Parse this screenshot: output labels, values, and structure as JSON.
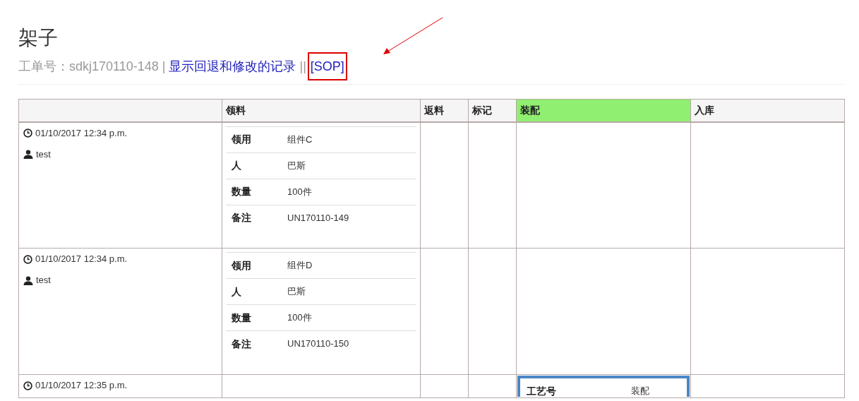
{
  "page": {
    "title": "架子",
    "order_label": "工单号：",
    "order_number": "sdkj170110-148",
    "separator": "|",
    "history_link": "显示回退和修改的记录",
    "separator_2": "||",
    "sop_link": "[SOP]",
    "sop_highlighted": true
  },
  "table": {
    "columns": [
      {
        "highlighted": false
      },
      {
        "label": "领料",
        "highlighted": false
      },
      {
        "label": "返料",
        "highlighted": false
      },
      {
        "label": "标记",
        "highlighted": false
      },
      {
        "label": "装配",
        "highlighted": true
      },
      {
        "label": "入库",
        "highlighted": false
      }
    ],
    "rows": [
      {
        "time": "01/10/2017 12:34 p.m.",
        "user": "test",
        "requisition": [
          {
            "label": "领用",
            "value": "组件C"
          },
          {
            "label": "人",
            "value": "巴斯"
          },
          {
            "label": "数量",
            "value": "100件"
          },
          {
            "label": "备注",
            "value": "UN170110-149"
          }
        ],
        "assembly": []
      },
      {
        "time": "01/10/2017 12:34 p.m.",
        "user": "test",
        "requisition": [
          {
            "label": "领用",
            "value": "组件D"
          },
          {
            "label": "人",
            "value": "巴斯"
          },
          {
            "label": "数量",
            "value": "100件"
          },
          {
            "label": "备注",
            "value": "UN170110-150"
          }
        ],
        "assembly": []
      },
      {
        "time": "01/10/2017 12:35 p.m.",
        "requisition": [],
        "assembly": [
          {
            "label": "工艺号",
            "value": "装配"
          }
        ]
      }
    ]
  }
}
